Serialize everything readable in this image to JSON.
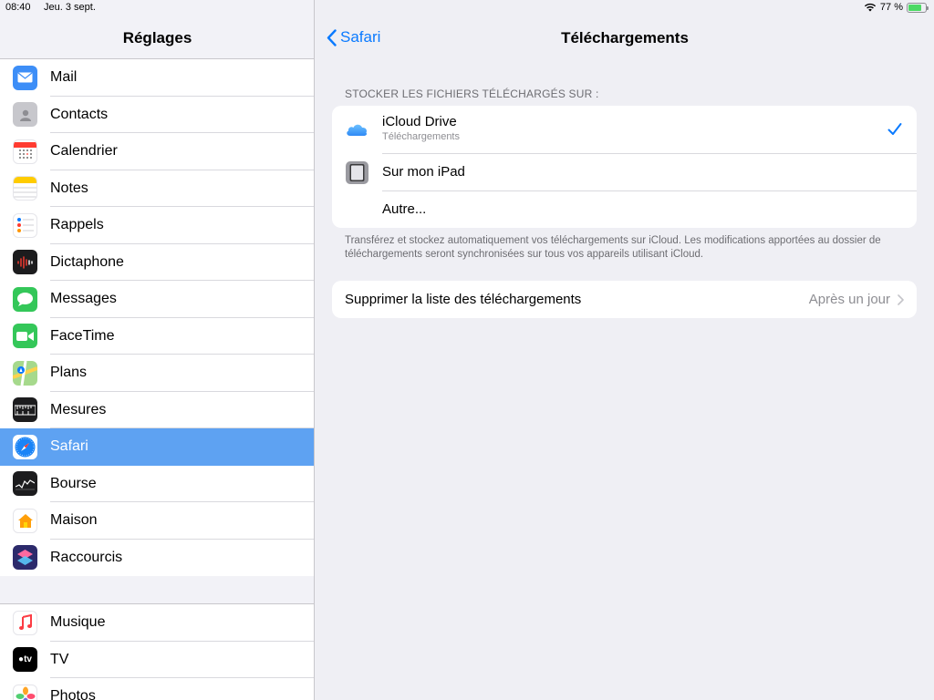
{
  "status": {
    "time": "08:40",
    "date": "Jeu. 3 sept.",
    "battery": "77 %",
    "battery_level": 0.77,
    "wifi_icon": "wifi-icon"
  },
  "sidebar": {
    "title": "Réglages",
    "items": [
      {
        "label": "Mail",
        "icon": "mail-icon",
        "color": "#3d8ef7"
      },
      {
        "label": "Contacts",
        "icon": "contacts-icon",
        "color": "#b7b7bb"
      },
      {
        "label": "Calendrier",
        "icon": "calendar-icon",
        "color": "#ffffff"
      },
      {
        "label": "Notes",
        "icon": "notes-icon",
        "color": "#ffffff"
      },
      {
        "label": "Rappels",
        "icon": "reminders-icon",
        "color": "#ffffff"
      },
      {
        "label": "Dictaphone",
        "icon": "voice-memos-icon",
        "color": "#1c1c1e"
      },
      {
        "label": "Messages",
        "icon": "messages-icon",
        "color": "#34c759"
      },
      {
        "label": "FaceTime",
        "icon": "facetime-icon",
        "color": "#34c759"
      },
      {
        "label": "Plans",
        "icon": "maps-icon",
        "color": "#9ad27f"
      },
      {
        "label": "Mesures",
        "icon": "measure-icon",
        "color": "#1c1c1e"
      },
      {
        "label": "Safari",
        "icon": "safari-icon",
        "color": "#1a84f7",
        "selected": true
      },
      {
        "label": "Bourse",
        "icon": "stocks-icon",
        "color": "#1c1c1e"
      },
      {
        "label": "Maison",
        "icon": "home-icon",
        "color": "#ffffff"
      },
      {
        "label": "Raccourcis",
        "icon": "shortcuts-icon",
        "color": "#4b3ea8"
      }
    ],
    "items2": [
      {
        "label": "Musique",
        "icon": "music-icon",
        "color": "#ffffff"
      },
      {
        "label": "TV",
        "icon": "tv-icon",
        "color": "#000000"
      },
      {
        "label": "Photos",
        "icon": "photos-icon",
        "color": "#ffffff"
      }
    ]
  },
  "detail": {
    "back_label": "Safari",
    "title": "Téléchargements",
    "section_header": "STOCKER LES FICHIERS TÉLÉCHARGÉS SUR :",
    "options": [
      {
        "title": "iCloud Drive",
        "subtitle": "Téléchargements",
        "icon": "icloud-icon",
        "checked": true
      },
      {
        "title": "Sur mon iPad",
        "icon": "ipad-icon"
      },
      {
        "title": "Autre..."
      }
    ],
    "footer": "Transférez et stockez automatiquement vos téléchargements sur iCloud. Les modifications apportées au dossier de téléchargements seront synchronisées sur tous vos appareils utilisant iCloud.",
    "clear_label": "Supprimer la liste des téléchargements",
    "clear_value": "Après un jour",
    "accent": "#0a7aff"
  }
}
